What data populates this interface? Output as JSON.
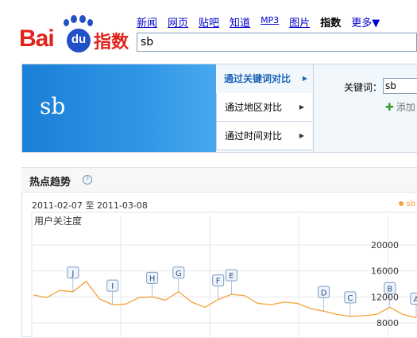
{
  "logo": {
    "bai": "Bai",
    "du": "du",
    "zhishu": "指数"
  },
  "nav": [
    {
      "label": "新闻"
    },
    {
      "label": "网页"
    },
    {
      "label": "贴吧"
    },
    {
      "label": "知道"
    },
    {
      "label": "MP3"
    },
    {
      "label": "图片"
    },
    {
      "label": "指数"
    },
    {
      "label": "更多▼"
    }
  ],
  "search": {
    "value": "sb"
  },
  "keyword_display": "sb",
  "compare_menu": [
    {
      "label": "通过关键词对比"
    },
    {
      "label": "通过地区对比"
    },
    {
      "label": "通过时间对比"
    }
  ],
  "keyword_panel": {
    "label": "关键词：",
    "value": "sb",
    "add_label": "添加"
  },
  "section": {
    "title": "热点趋势",
    "help": "?"
  },
  "chart": {
    "date_from": "2011-02-07",
    "date_sep": "至",
    "date_to": "2011-03-08",
    "legend": "sb",
    "line_color": "#f4a33a"
  },
  "chart_data": {
    "type": "line",
    "ylabel": "用户关注度",
    "y_ticks": [
      8000,
      12000,
      16000,
      20000
    ],
    "series": [
      {
        "name": "sb",
        "values": [
          12300,
          11900,
          13000,
          12800,
          14400,
          11700,
          10800,
          10900,
          11900,
          12000,
          11500,
          12800,
          11200,
          10400,
          11600,
          12400,
          12200,
          11000,
          10800,
          11200,
          11000,
          10200,
          9800,
          9300,
          9000,
          9100,
          9300,
          10400,
          9300,
          8800
        ]
      }
    ],
    "annotations": [
      "J",
      "I",
      "H",
      "G",
      "F",
      "E",
      "D",
      "C",
      "B",
      "A"
    ]
  }
}
